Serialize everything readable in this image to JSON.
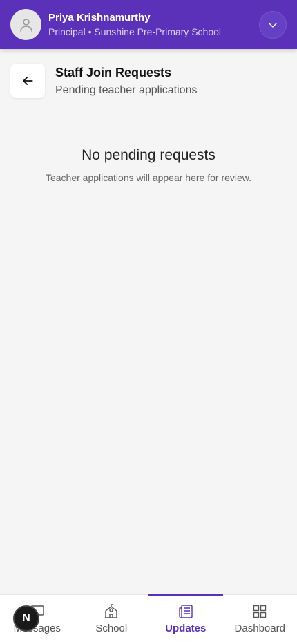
{
  "header": {
    "user_name": "Priya Krishnamurthy",
    "user_role": "Principal • Sunshine Pre-Primary School",
    "avatar_icon": "user-icon",
    "toggle_icon": "chevron-down-icon",
    "bg_color": "#5a31b8"
  },
  "page": {
    "back_icon": "arrow-left-icon",
    "title": "Staff Join Requests",
    "subtitle": "Pending teacher applications"
  },
  "empty_state": {
    "title": "No pending requests",
    "description": "Teacher applications will appear here for review."
  },
  "bottom_nav": {
    "items": [
      {
        "label": "Messages",
        "icon": "message-icon",
        "active": false
      },
      {
        "label": "School",
        "icon": "school-icon",
        "active": false
      },
      {
        "label": "Updates",
        "icon": "newspaper-icon",
        "active": true
      },
      {
        "label": "Dashboard",
        "icon": "grid-icon",
        "active": false
      }
    ],
    "accent_color": "#5a31b8"
  },
  "floating_badge": {
    "label": "N"
  }
}
